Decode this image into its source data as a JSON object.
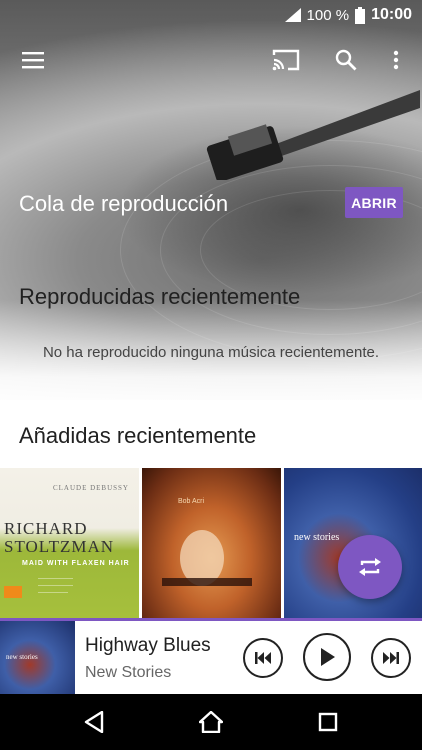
{
  "status_bar": {
    "battery": "100 %",
    "time": "10:00"
  },
  "queue": {
    "title": "Cola de reproducción",
    "open_button": "ABRIR"
  },
  "recently_played": {
    "title": "Reproducidas recientemente",
    "empty_message": "No ha reproducido ninguna música recientemente."
  },
  "recently_added": {
    "title": "Añadidas recientemente",
    "albums": [
      {
        "top_text": "CLAUDE DEBUSSY",
        "artist": "RICHARD STOLTZMAN",
        "subtitle": "MAID WITH FLAXEN HAIR"
      },
      {
        "top_text": "Bob Acri"
      },
      {
        "top_text": "new stories"
      }
    ]
  },
  "now_playing": {
    "title": "Highway Blues",
    "artist": "New Stories",
    "art_text": "new stories",
    "progress": 1.0
  },
  "colors": {
    "accent": "#7e57c2"
  },
  "icons": {
    "app_bar": [
      "menu-icon",
      "cast-icon",
      "search-icon",
      "more-vert-icon"
    ],
    "player": [
      "skip-previous-icon",
      "play-icon",
      "skip-next-icon"
    ],
    "nav": [
      "back-icon",
      "home-icon",
      "recents-icon"
    ]
  }
}
